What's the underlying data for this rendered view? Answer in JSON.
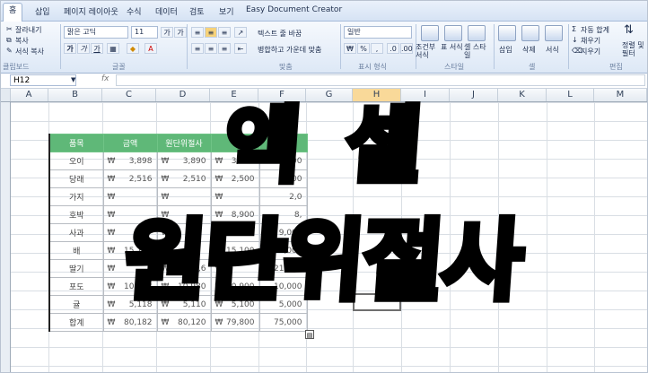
{
  "tabs": [
    "홈",
    "삽입",
    "페이지 레이아웃",
    "수식",
    "데이터",
    "검토",
    "보기",
    "Easy Document Creator"
  ],
  "clipboard": {
    "cut": "잘라내기",
    "copy": "복사",
    "format_painter": "서식 복사",
    "label": "클립보드"
  },
  "font": {
    "name": "맑은 고딕",
    "size": "11",
    "grow": "가",
    "shrink": "가",
    "bold": "가",
    "italic": "가",
    "underline": "가",
    "label": "글꼴"
  },
  "alignment": {
    "wrap_text": "텍스트 줄 바꿈",
    "merge_center": "병합하고 가운데 맞춤",
    "label": "맞춤"
  },
  "number": {
    "format": "일반",
    "label": "표시 형식"
  },
  "styles": {
    "conditional": "조건부 서식",
    "table_format": "표 서식",
    "cell_style": "셀 스타일",
    "label": "스타일"
  },
  "cells": {
    "insert": "삽입",
    "delete": "삭제",
    "format": "서식",
    "label": "셀"
  },
  "editing": {
    "autosum": "자동 합계",
    "fill": "채우기",
    "clear": "지우기",
    "sort_filter": "정렬 및 필터",
    "label": "편집"
  },
  "formula_bar": {
    "name_box": "H12",
    "fx": "fx",
    "value": ""
  },
  "columns": [
    "A",
    "B",
    "C",
    "D",
    "E",
    "F",
    "G",
    "H",
    "I",
    "J",
    "K",
    "L",
    "M"
  ],
  "selected_column": "H",
  "table": {
    "headers": [
      "품목",
      "금액",
      "원단위절사",
      ""
    ],
    "currency": "₩",
    "rows": [
      {
        "name": "오이",
        "v1": "3,898",
        "v2": "3,890",
        "v3": "3,800",
        "v4": "3,000"
      },
      {
        "name": "당래",
        "v1": "2,516",
        "v2": "2,510",
        "v3": "2,500",
        "v4": "2,000"
      },
      {
        "name": "가지",
        "v1": "",
        "v2": "",
        "v3": "",
        "v4": "2,0"
      },
      {
        "name": "호박",
        "v1": "",
        "v2": "",
        "v3": "8,900",
        "v4": "8,"
      },
      {
        "name": "사과",
        "v1": "",
        "v2": "",
        "v3": "",
        "v4": "9,000"
      },
      {
        "name": "배",
        "v1": "15,133",
        "v2": "",
        "v3": "15,100",
        "v4": "15,000"
      },
      {
        "name": "딸기",
        "v1": "",
        "v2": "21,6",
        "v3": "",
        "v4": "21,000"
      },
      {
        "name": "포도",
        "v1": "10,988",
        "v2": "10,980",
        "v3": "10,900",
        "v4": "10,000"
      },
      {
        "name": "귤",
        "v1": "5,118",
        "v2": "5,110",
        "v3": "5,100",
        "v4": "5,000"
      },
      {
        "name": "합계",
        "v1": "80,182",
        "v2": "80,120",
        "v3": "79,800",
        "v4": "75,000"
      }
    ]
  },
  "overlay": {
    "line1": "엑셀",
    "line2": "원단위절사"
  }
}
